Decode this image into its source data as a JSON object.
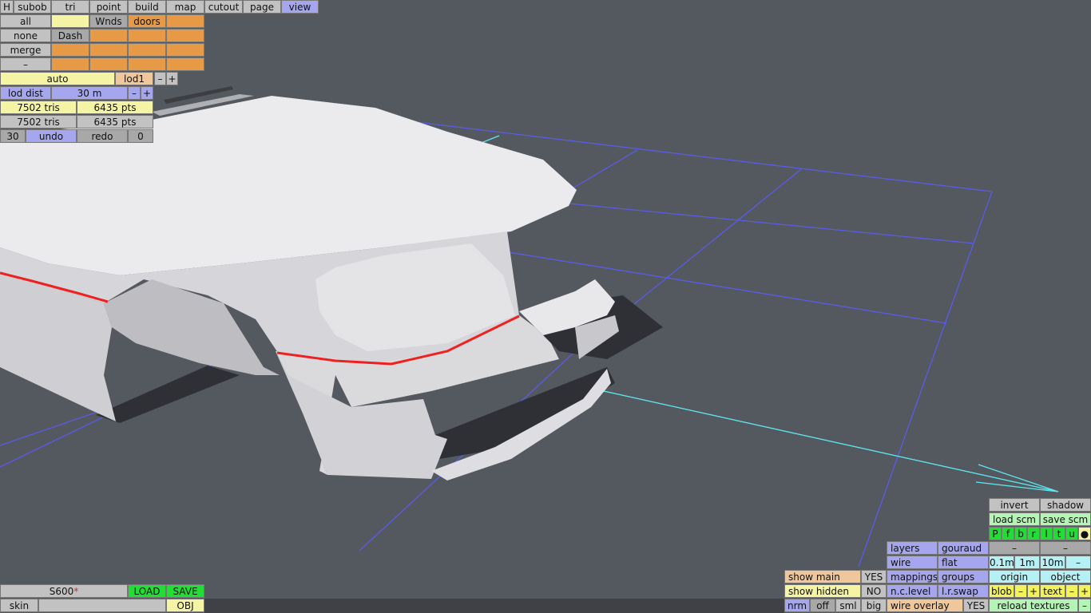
{
  "colors": {
    "background": "#54585f",
    "grid": "#5a5ce8",
    "axis": "#5ee6ee",
    "body": "#d8d8dc",
    "trim": "#ee2020",
    "shadow": "#2e3036"
  },
  "top_menu": {
    "tabs": [
      "H",
      "subob",
      "tri",
      "point",
      "build",
      "map",
      "cutout",
      "page",
      "view"
    ],
    "active_tab": "view"
  },
  "subob_panel": {
    "all": "all",
    "none": "none",
    "merge": "merge",
    "minus": "–",
    "wnds": "Wnds",
    "doors": "doors",
    "dash": "Dash"
  },
  "lod": {
    "auto": "auto",
    "level": "lod1",
    "minus": "–",
    "plus": "+",
    "dist_label": "lod dist",
    "dist_value": "30 m",
    "dist_minus": "–",
    "dist_plus": "+"
  },
  "stats": {
    "tris_1": "7502 tris",
    "pts_1": "6435 pts",
    "tris_2": "7502 tris",
    "pts_2": "6435 pts",
    "undo_count": "30",
    "undo": "undo",
    "redo": "redo",
    "redo_count": "0"
  },
  "file": {
    "name": "S600",
    "modified_mark": "*",
    "load": "LOAD",
    "save": "SAVE",
    "skin": "skin",
    "obj": "OBJ"
  },
  "display": {
    "show_main": "show main",
    "show_main_value": "YES",
    "show_hidden": "show hidden",
    "show_hidden_value": "NO",
    "nrm": "nrm",
    "off": "off",
    "sml": "sml",
    "big": "big",
    "layers": "layers",
    "gouraud": "gouraud",
    "wire": "wire",
    "flat": "flat",
    "mappings": "mappings",
    "groups": "groups",
    "nc_level": "n.c.level",
    "lr_swap": "l.r.swap",
    "wire_overlay": "wire overlay",
    "wire_overlay_value": "YES"
  },
  "right_panel": {
    "invert": "invert",
    "shadow": "shadow",
    "load_scm": "load scm",
    "save_scm": "save scm",
    "views": [
      "P",
      "f",
      "b",
      "r",
      "l",
      "t",
      "u",
      "●"
    ],
    "dash_a": "–",
    "dash_b": "–",
    "step_1": "0.1m",
    "step_2": "1m",
    "step_3": "10m",
    "step_minus": "–",
    "origin": "origin",
    "object": "object",
    "blob": "blob",
    "blob_minus": "–",
    "blob_plus": "+",
    "text": "text",
    "text_minus": "–",
    "text_plus": "+",
    "reload_textures": "reload textures",
    "reload_minus": "–"
  }
}
